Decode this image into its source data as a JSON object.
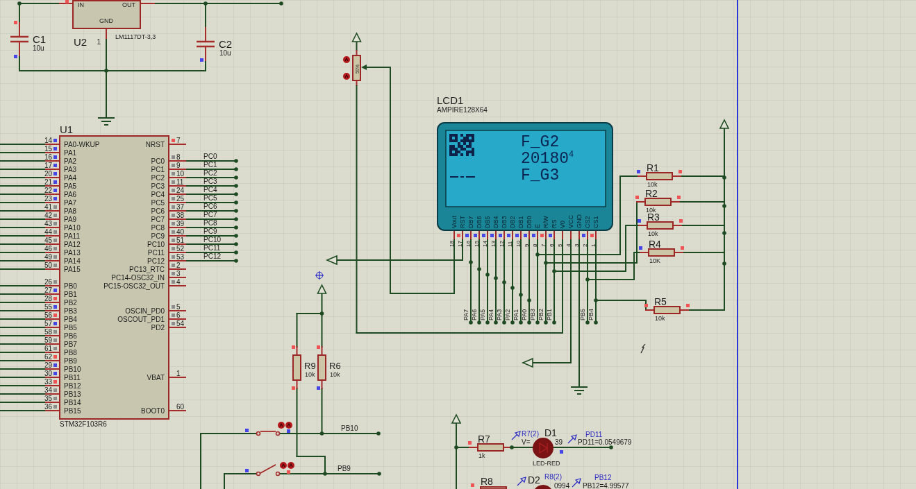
{
  "regulator": {
    "ref": "U2",
    "part": "LM1117DT-3,3",
    "pins": [
      {
        "name": "IN",
        "color": "#ef5353"
      },
      {
        "name": "OUT"
      },
      {
        "name": "GND",
        "number": "1"
      }
    ]
  },
  "capacitors": [
    {
      "ref": "C1",
      "value": "10u",
      "pins": [
        {
          "color": "#ef5353"
        },
        {
          "color": "#4646e8"
        }
      ]
    },
    {
      "ref": "C2",
      "value": "10u",
      "pins": [
        {
          "color": "#4646e8"
        }
      ]
    }
  ],
  "potentiometer": {
    "setting": "50%"
  },
  "lcd": {
    "ref": "LCD1",
    "part": "AMPIRE128X64",
    "screen_lines": [
      "F_G2",
      "20180$^{4}$",
      "F_G3"
    ],
    "pins": [
      {
        "name": "Vout",
        "number": "18"
      },
      {
        "name": "RST",
        "number": "17",
        "color": "#ef5353"
      },
      {
        "name": "DB7",
        "number": "16",
        "color": "#4646e8",
        "net_label": "PA7"
      },
      {
        "name": "DB6",
        "number": "15",
        "color": "#4646e8",
        "net_label": "PA6"
      },
      {
        "name": "DB5",
        "number": "14",
        "color": "#4646e8",
        "net_label": "PA5"
      },
      {
        "name": "DB4",
        "number": "13",
        "color": "#4646e8",
        "net_label": "PA4"
      },
      {
        "name": "DB3",
        "number": "12",
        "color": "#4646e8",
        "net_label": "PA3"
      },
      {
        "name": "DB2",
        "number": "11",
        "color": "#4646e8",
        "net_label": "PA2"
      },
      {
        "name": "DB1",
        "number": "10",
        "color": "#4646e8",
        "net_label": "PA1"
      },
      {
        "name": "DB0",
        "number": "9",
        "color": "#4646e8",
        "net_label": "PA0"
      },
      {
        "name": "E",
        "number": "8",
        "color": "#4646e8",
        "net_label": "PB3"
      },
      {
        "name": "R/W",
        "number": "7",
        "color": "#ef5353",
        "net_label": "PB2"
      },
      {
        "name": "RS",
        "number": "6",
        "color": "#4646e8",
        "net_label": "PB1"
      },
      {
        "name": "V0",
        "number": "5"
      },
      {
        "name": "VCC",
        "number": "4"
      },
      {
        "name": "GND",
        "number": "3"
      },
      {
        "name": "CS2",
        "number": "2",
        "color": "#4646e8",
        "net_label": "PB5"
      },
      {
        "name": "CS1",
        "number": "1",
        "color": "#ef5353",
        "net_label": "PB4"
      }
    ]
  },
  "mcu": {
    "ref": "U1",
    "part": "STM32F103R6",
    "left_pin_groups": [
      [
        {
          "name": "PA0-WKUP",
          "number": "14",
          "color": "#4646e8"
        },
        {
          "name": "PA1",
          "number": "15",
          "color": "#4646e8"
        },
        {
          "name": "PA2",
          "number": "16",
          "color": "#4646e8"
        },
        {
          "name": "PA3",
          "number": "17",
          "color": "#4646e8"
        },
        {
          "name": "PA4",
          "number": "20",
          "color": "#4646e8"
        },
        {
          "name": "PA5",
          "number": "21",
          "color": "#4646e8"
        },
        {
          "name": "PA6",
          "number": "22",
          "color": "#4646e8"
        },
        {
          "name": "PA7",
          "number": "23",
          "color": "#4646e8"
        },
        {
          "name": "PA8",
          "number": "41",
          "color": "#8c8c8c"
        },
        {
          "name": "PA9",
          "number": "42",
          "color": "#8c8c8c"
        },
        {
          "name": "PA10",
          "number": "43",
          "color": "#8c8c8c"
        },
        {
          "name": "PA11",
          "number": "44",
          "color": "#8c8c8c"
        },
        {
          "name": "PA12",
          "number": "45",
          "color": "#8c8c8c"
        },
        {
          "name": "PA13",
          "number": "46",
          "color": "#8c8c8c"
        },
        {
          "name": "PA14",
          "number": "49",
          "color": "#8c8c8c"
        },
        {
          "name": "PA15",
          "number": "50",
          "color": "#8c8c8c"
        }
      ],
      [
        {
          "name": "PB0",
          "number": "26",
          "color": "#8c8c8c"
        },
        {
          "name": "PB1",
          "number": "27",
          "color": "#4646e8"
        },
        {
          "name": "PB2",
          "number": "28",
          "color": "#ef5353"
        },
        {
          "name": "PB3",
          "number": "55",
          "color": "#4646e8"
        },
        {
          "name": "PB4",
          "number": "56",
          "color": "#ef5353"
        },
        {
          "name": "PB5",
          "number": "57",
          "color": "#4646e8"
        },
        {
          "name": "PB6",
          "number": "58",
          "color": "#8c8c8c"
        },
        {
          "name": "PB7",
          "number": "59",
          "color": "#8c8c8c"
        },
        {
          "name": "PB8",
          "number": "61",
          "color": "#8c8c8c"
        },
        {
          "name": "PB9",
          "number": "62",
          "color": "#ef5353"
        },
        {
          "name": "PB10",
          "number": "29",
          "color": "#4646e8"
        },
        {
          "name": "PB11",
          "number": "30",
          "color": "#4646e8"
        },
        {
          "name": "PB12",
          "number": "33",
          "color": "#ef5353"
        },
        {
          "name": "PB13",
          "number": "34",
          "color": "#8c8c8c"
        },
        {
          "name": "PB14",
          "number": "35",
          "color": "#8c8c8c"
        },
        {
          "name": "PB15",
          "number": "36",
          "color": "#8c8c8c"
        }
      ]
    ],
    "right_pin_groups": [
      [
        {
          "name": "NRST",
          "number": "7",
          "color": "#ef5353"
        }
      ],
      [
        {
          "name": "PC0",
          "number": "8",
          "color": "#8c8c8c",
          "net_label": "PC0"
        },
        {
          "name": "PC1",
          "number": "9",
          "color": "#8c8c8c",
          "net_label": "PC1"
        },
        {
          "name": "PC2",
          "number": "10",
          "color": "#8c8c8c",
          "net_label": "PC2"
        },
        {
          "name": "PC3",
          "number": "11",
          "color": "#8c8c8c",
          "net_label": "PC3"
        },
        {
          "name": "PC4",
          "number": "24",
          "color": "#8c8c8c",
          "net_label": "PC4"
        },
        {
          "name": "PC5",
          "number": "25",
          "color": "#8c8c8c",
          "net_label": "PC5"
        },
        {
          "name": "PC6",
          "number": "37",
          "color": "#8c8c8c",
          "net_label": "PC6"
        },
        {
          "name": "PC7",
          "number": "38",
          "color": "#8c8c8c",
          "net_label": "PC7"
        },
        {
          "name": "PC8",
          "number": "39",
          "color": "#8c8c8c",
          "net_label": "PC8"
        },
        {
          "name": "PC9",
          "number": "40",
          "color": "#8c8c8c",
          "net_label": "PC9"
        },
        {
          "name": "PC10",
          "number": "51",
          "color": "#8c8c8c",
          "net_label": "PC10"
        },
        {
          "name": "PC11",
          "number": "52",
          "color": "#8c8c8c",
          "net_label": "PC11"
        },
        {
          "name": "PC12",
          "number": "53",
          "color": "#8c8c8c",
          "net_label": "PC12"
        },
        {
          "name": "PC13_RTC",
          "number": "2",
          "color": "#8c8c8c"
        },
        {
          "name": "PC14-OSC32_IN",
          "number": "3",
          "color": "#8c8c8c"
        },
        {
          "name": "PC15-OSC32_OUT",
          "number": "4",
          "color": "#8c8c8c"
        }
      ],
      [
        {
          "name": "OSCIN_PD0",
          "number": "5",
          "color": "#8c8c8c"
        },
        {
          "name": "OSCOUT_PD1",
          "number": "6",
          "color": "#8c8c8c"
        },
        {
          "name": "PD2",
          "number": "54",
          "color": "#8c8c8c"
        }
      ],
      [
        {
          "name": "VBAT",
          "number": "1"
        }
      ],
      [
        {
          "name": "BOOT0",
          "number": "60"
        }
      ]
    ]
  },
  "resistors": [
    {
      "ref": "R1",
      "value": "10k",
      "pins": [
        {
          "color": "#4646e8"
        },
        {
          "color": "#ef5353"
        }
      ]
    },
    {
      "ref": "R2",
      "value": "10k",
      "pins": [
        {
          "color": "#ef5353"
        },
        {
          "color": "#ef5353"
        }
      ]
    },
    {
      "ref": "R3",
      "value": "10k",
      "pins": [
        {
          "color": "#4646e8"
        },
        {
          "color": "#ef5353"
        }
      ]
    },
    {
      "ref": "R4",
      "value": "10K",
      "pins": [
        {
          "color": "#4646e8"
        },
        {
          "color": "#ef5353"
        }
      ]
    },
    {
      "ref": "R5",
      "value": "10k",
      "pins": [
        {
          "color": "#ef5353"
        },
        {
          "color": "#ef5353"
        }
      ]
    },
    {
      "ref": "R9",
      "value": "10k",
      "pins": [
        {
          "color": "#ef5353"
        },
        {
          "color": "#ef5353"
        }
      ]
    },
    {
      "ref": "R6",
      "value": "10k",
      "pins": [
        {
          "color": "#ef5353"
        },
        {
          "color": "#4646e8"
        }
      ]
    },
    {
      "ref": "R7",
      "value": "1k",
      "pins": [
        {
          "color": "#ef5353"
        }
      ]
    },
    {
      "ref": "R8",
      "pins": [
        {
          "color": "#ef5353"
        }
      ]
    }
  ],
  "switches": [
    {
      "closed": true,
      "net_label": "PB10",
      "pins": [
        {
          "color": "#4646e8"
        },
        {
          "color": "#4646e8"
        }
      ]
    },
    {
      "closed": false,
      "net_label": "PB9",
      "pins": [
        {
          "color": "#4646e8"
        },
        {
          "color": "#ef5353"
        }
      ]
    }
  ],
  "leds": [
    {
      "ref": "D1",
      "part": "LED-RED",
      "lit": false,
      "pins": [
        {
          "color": "#4646e8"
        }
      ]
    },
    {
      "ref": "D2",
      "lit": false
    }
  ],
  "probes": [
    {
      "name": "R7(2)",
      "reading_parts": [
        "V=",
        "39"
      ]
    },
    {
      "name": "PD11",
      "reading_parts": [
        "PD11=0.0549679"
      ]
    },
    {
      "name": "R8(2)",
      "reading_parts": [
        "0994"
      ]
    },
    {
      "name": "PB12",
      "reading_parts": [
        "PB12=4.99577"
      ]
    }
  ]
}
